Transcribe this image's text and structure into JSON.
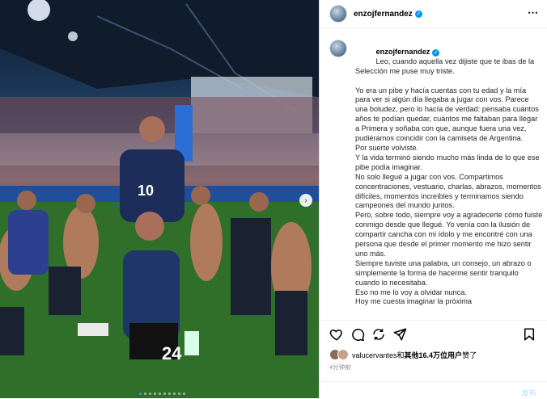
{
  "post": {
    "username": "enzojfernandez",
    "more_icon": "⋯",
    "caption_username": "enzojfernandez",
    "caption_paragraphs": [
      "Leo, cuando aquella vez dijiste que te ibas de la Selección me puse muy triste.",
      "Yo era un pibe y hacía cuentas con tu edad y la mía para ver si algún día llegaba a jugar con vos. Parece una boludez, pero lo hacía de verdad: pensaba cuántos años te podían quedar, cuántos me faltaban para llegar a Primera y soñaba con que, aunque fuera una vez, pudiéramos coincidir con la camiseta de Argentina.",
      "Por suerte volviste.",
      "Y la vida terminó siendo mucho más linda de lo que ese pibe podía imaginar.",
      "No solo llegué a jugar con vos. Compartimos concentraciones, vestuario, charlas, abrazos, momentos difíciles, momentos increíbles y terminamos siendo campeones del mundo juntos.",
      "Pero, sobre todo, siempre voy a agradecerte cómo fuiste conmigo desde que llegué. Yo venía con la ilusión de compartir cancha con mi ídolo y me encontré con una persona que desde el primer momento me hizo sentir uno más.",
      "Siempre tuviste una palabra, un consejo, un abrazo o simplemente la forma de hacerme sentir tranquilo cuando lo necesitaba.",
      "Eso no me lo voy a olvidar nunca.",
      "Hoy me cuesta imaginar la próxima"
    ],
    "likes_text_pre": "valucervantes和",
    "likes_text_bold": "其他16.4万位用户",
    "likes_text_post": "赞了",
    "timestamp": "4分钟前",
    "comment_post_label": "发布",
    "colors": {
      "accent": "#0095f6",
      "post_disabled": "#b2dffc",
      "muted": "#8e8e8e"
    },
    "icons": [
      "heart-icon",
      "comment-icon",
      "share-icon",
      "bookmark-icon",
      "verified-icon",
      "chevron-right-icon"
    ],
    "carousel": {
      "total": 10,
      "active": 0
    },
    "photo_text": {
      "jersey_front": "10",
      "jersey_back": "24"
    }
  }
}
